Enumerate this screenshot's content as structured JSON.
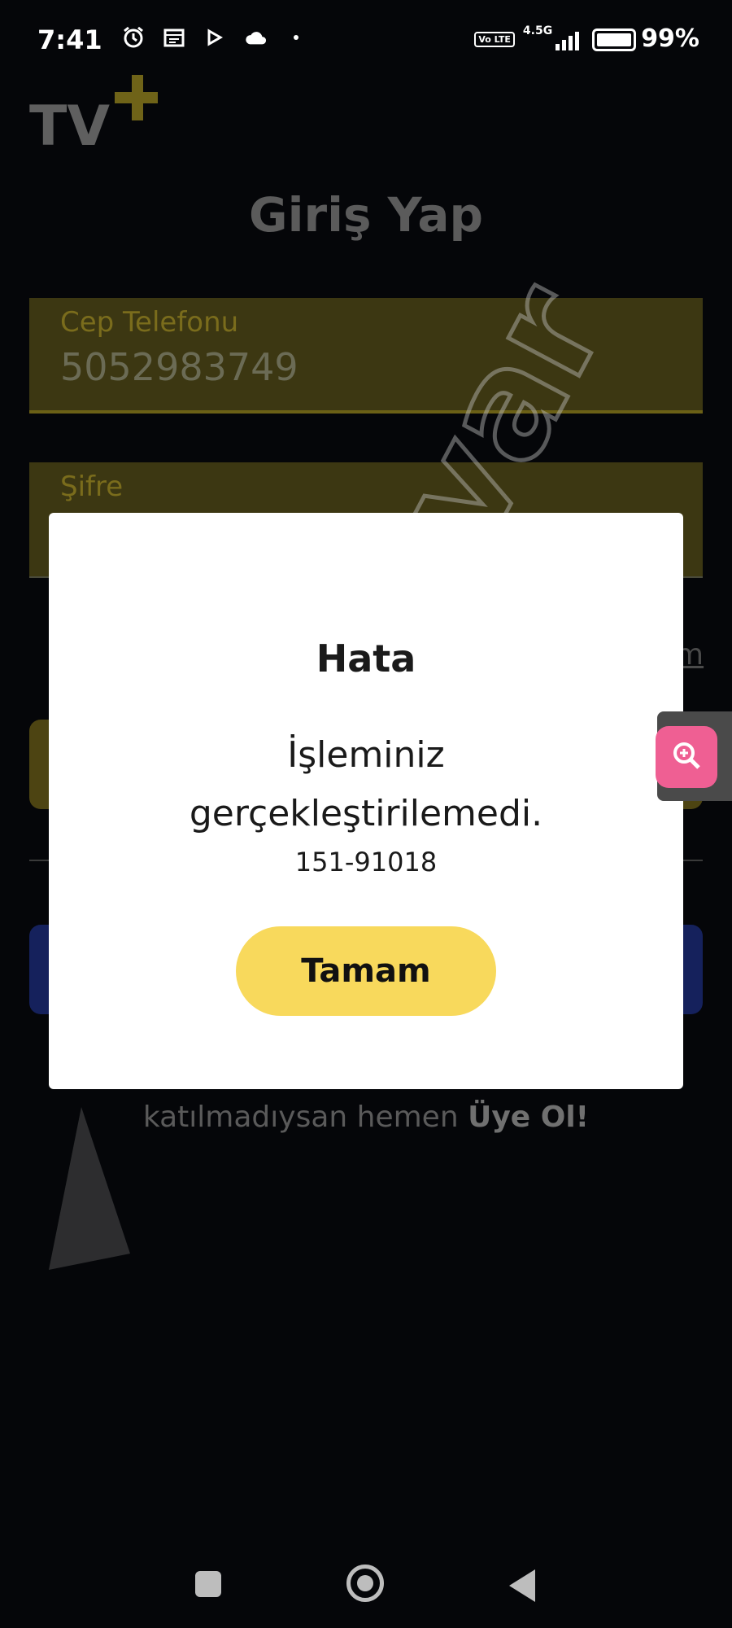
{
  "status_bar": {
    "time": "7:41",
    "network_type": "4.5G",
    "volte_badge": "Vo LTE",
    "battery": "99%"
  },
  "app": {
    "logo_text": "TV+",
    "page_title": "Giriş Yap",
    "phone_field": {
      "label": "Cep Telefonu",
      "value": "5052983749"
    },
    "password_field": {
      "label": "Şifre",
      "value": ""
    },
    "forgot_link_partial": "m",
    "signup": {
      "text": "katılmadıysan hemen ",
      "link": "Üye Ol!"
    }
  },
  "dialog": {
    "title": "Hata",
    "message": "İşleminiz gerçekleştirilemedi.",
    "code": "151-91018",
    "ok_label": "Tamam"
  },
  "colors": {
    "accent_yellow": "#f8d95c",
    "zoom_pink": "#ef5f93",
    "field_bg": "#3c3712"
  },
  "icons": {
    "zoom": "zoom-in-icon",
    "nav_recents": "recents-icon",
    "nav_home": "home-icon",
    "nav_back": "back-icon"
  },
  "watermark_text": "şikayetvar"
}
